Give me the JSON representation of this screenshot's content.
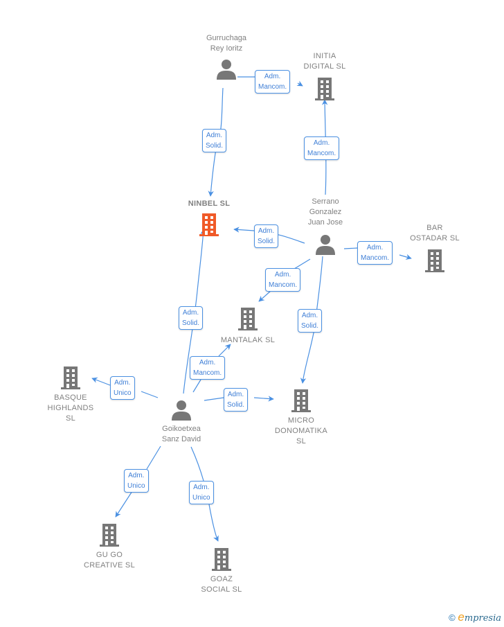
{
  "colors": {
    "edge": "#4a90e2",
    "node_icon": "#777777",
    "highlight_icon": "#f05a28",
    "label": "#808080"
  },
  "nodes": [
    {
      "id": "gurruchaga",
      "type": "person",
      "label": "Gurruchaga\nRey Ioritz"
    },
    {
      "id": "initia",
      "type": "company",
      "label": "INITIA\nDIGITAL  SL"
    },
    {
      "id": "ninbel",
      "type": "company",
      "label": "NINBEL  SL",
      "highlight": true
    },
    {
      "id": "serrano",
      "type": "person",
      "label": "Serrano\nGonzalez\nJuan Jose"
    },
    {
      "id": "bar",
      "type": "company",
      "label": "BAR\nOSTADAR SL"
    },
    {
      "id": "mantalak",
      "type": "company",
      "label": "MANTALAK  SL"
    },
    {
      "id": "basque",
      "type": "company",
      "label": "BASQUE\nHIGHLANDS\nSL"
    },
    {
      "id": "goikoetxea",
      "type": "person",
      "label": "Goikoetxea\nSanz David"
    },
    {
      "id": "micro",
      "type": "company",
      "label": "MICRO\nDONOMATIKA\nSL"
    },
    {
      "id": "gugo",
      "type": "company",
      "label": "GU GO\nCREATIVE  SL"
    },
    {
      "id": "goaz",
      "type": "company",
      "label": "GOAZ\nSOCIAL  SL"
    }
  ],
  "edges": [
    {
      "from": "gurruchaga",
      "to": "initia",
      "label": "Adm.\nMancom."
    },
    {
      "from": "gurruchaga",
      "to": "ninbel",
      "label": "Adm.\nSolid."
    },
    {
      "from": "serrano",
      "to": "initia",
      "label": "Adm.\nMancom."
    },
    {
      "from": "serrano",
      "to": "ninbel",
      "label": "Adm.\nSolid."
    },
    {
      "from": "serrano",
      "to": "bar",
      "label": "Adm.\nMancom."
    },
    {
      "from": "serrano",
      "to": "mantalak",
      "label": "Adm.\nMancom."
    },
    {
      "from": "serrano",
      "to": "micro",
      "label": "Adm.\nSolid."
    },
    {
      "from": "goikoetxea",
      "to": "ninbel",
      "label": "Adm.\nSolid."
    },
    {
      "from": "goikoetxea",
      "to": "mantalak",
      "label": "Adm.\nMancom."
    },
    {
      "from": "goikoetxea",
      "to": "basque",
      "label": "Adm.\nUnico"
    },
    {
      "from": "goikoetxea",
      "to": "micro",
      "label": "Adm.\nSolid."
    },
    {
      "from": "goikoetxea",
      "to": "gugo",
      "label": "Adm.\nUnico"
    },
    {
      "from": "goikoetxea",
      "to": "goaz",
      "label": "Adm.\nUnico"
    }
  ],
  "footer": {
    "copyright_symbol": "©",
    "brand_initial": "e",
    "brand_rest": "mpresia"
  }
}
